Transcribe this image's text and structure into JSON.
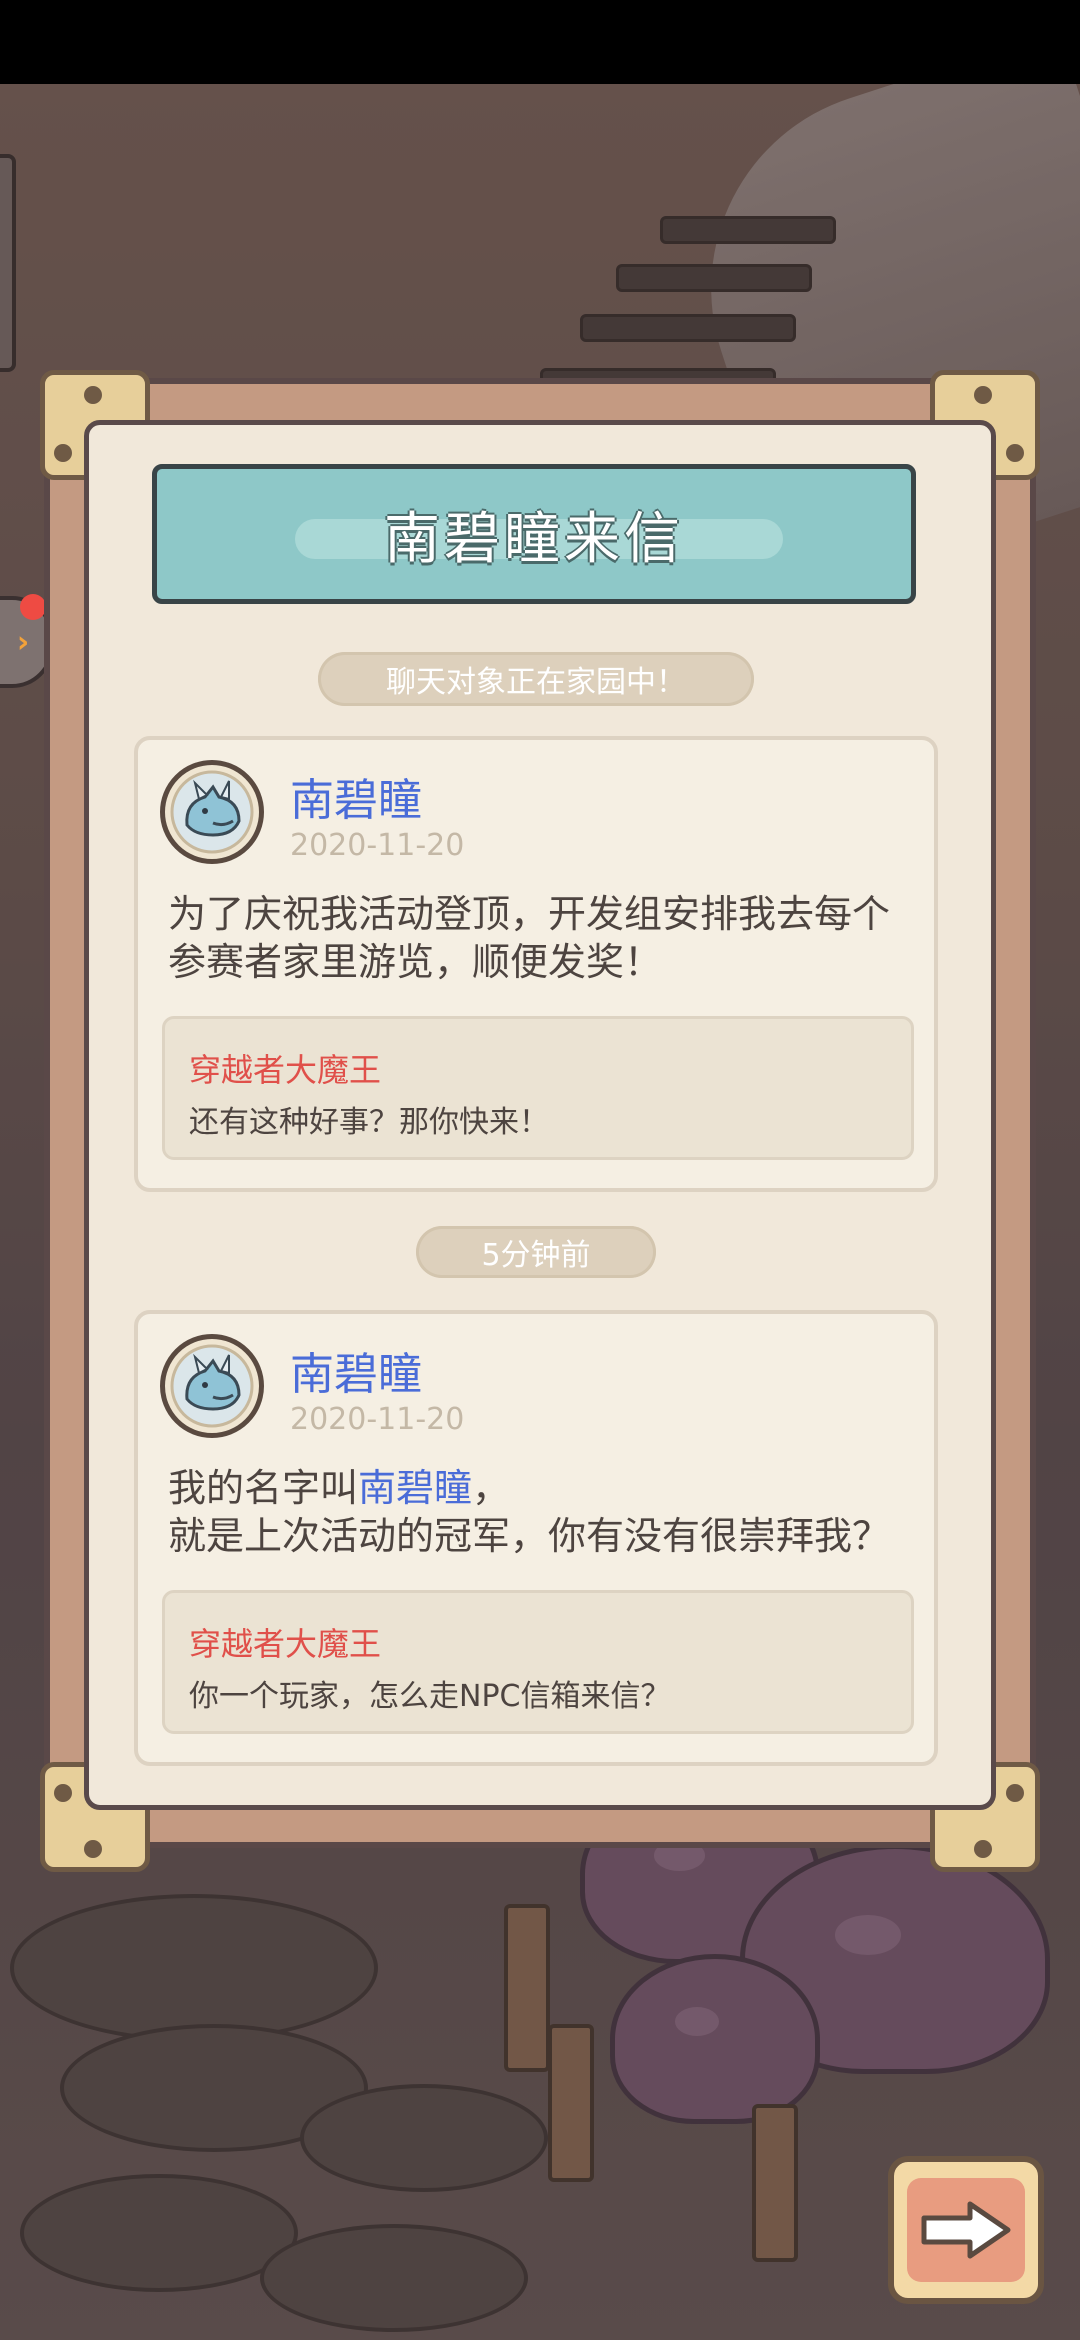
{
  "dialog": {
    "title": "南碧瞳来信",
    "status_notice": "聊天对象正在家园中！"
  },
  "letters": [
    {
      "sender": "南碧瞳",
      "date": "2020-11-20",
      "message_line1": "为了庆祝我活动登顶，开发组安排我去每个",
      "message_line2": "参赛者家里游览，顺便发奖！",
      "reply_name": "穿越者大魔王",
      "reply_text": "还有这种好事？那你快来！"
    },
    {
      "sender": "南碧瞳",
      "date": "2020-11-20",
      "message_line1_prefix": "我的名字叫",
      "message_line1_name": "南碧瞳",
      "message_line1_suffix": "，",
      "message_line2": "就是上次活动的冠军，你有没有很崇拜我？",
      "reply_name": "穿越者大魔王",
      "reply_text": "你一个玩家，怎么走NPC信箱来信？"
    }
  ],
  "time_divider": "5分钟前",
  "icons": {
    "side": "chevron-right-icon",
    "next": "arrow-right-icon",
    "avatar": "dragon-avatar-icon"
  },
  "colors": {
    "name_blue": "#4a6cd8",
    "reply_red": "#e0504a",
    "title_teal": "#8ec8c8"
  }
}
